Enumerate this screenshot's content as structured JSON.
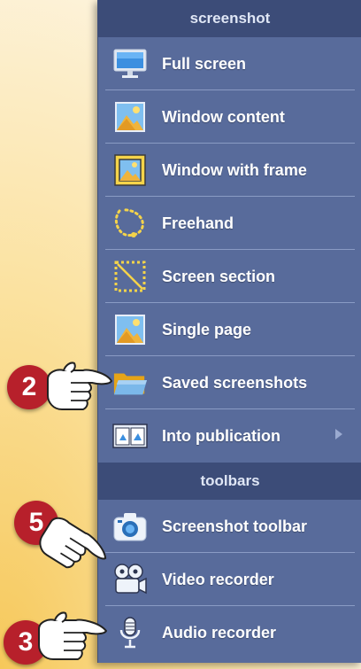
{
  "menu": {
    "section_screenshot": "screenshot",
    "section_toolbars": "toolbars",
    "items": [
      {
        "label": "Full screen",
        "icon": "monitor-icon"
      },
      {
        "label": "Window content",
        "icon": "image-icon"
      },
      {
        "label": "Window with frame",
        "icon": "framed-image-icon"
      },
      {
        "label": "Freehand",
        "icon": "lasso-icon"
      },
      {
        "label": "Screen section",
        "icon": "selection-icon"
      },
      {
        "label": "Single page",
        "icon": "image-icon"
      },
      {
        "label": "Saved screenshots",
        "icon": "folder-icon"
      },
      {
        "label": "Into publication",
        "icon": "book-icon",
        "has_submenu": true
      }
    ],
    "toolbar_items": [
      {
        "label": "Screenshot toolbar",
        "icon": "camera-icon"
      },
      {
        "label": "Video recorder",
        "icon": "film-camera-icon"
      },
      {
        "label": "Audio recorder",
        "icon": "microphone-icon"
      }
    ]
  },
  "callouts": [
    {
      "number": "2",
      "target": "Saved screenshots"
    },
    {
      "number": "5",
      "target": "Video recorder"
    },
    {
      "number": "3",
      "target": "Audio recorder"
    }
  ],
  "colors": {
    "menu_bg": "#586b9b",
    "header_bg": "#3c4c78",
    "badge": "#b7202b"
  }
}
